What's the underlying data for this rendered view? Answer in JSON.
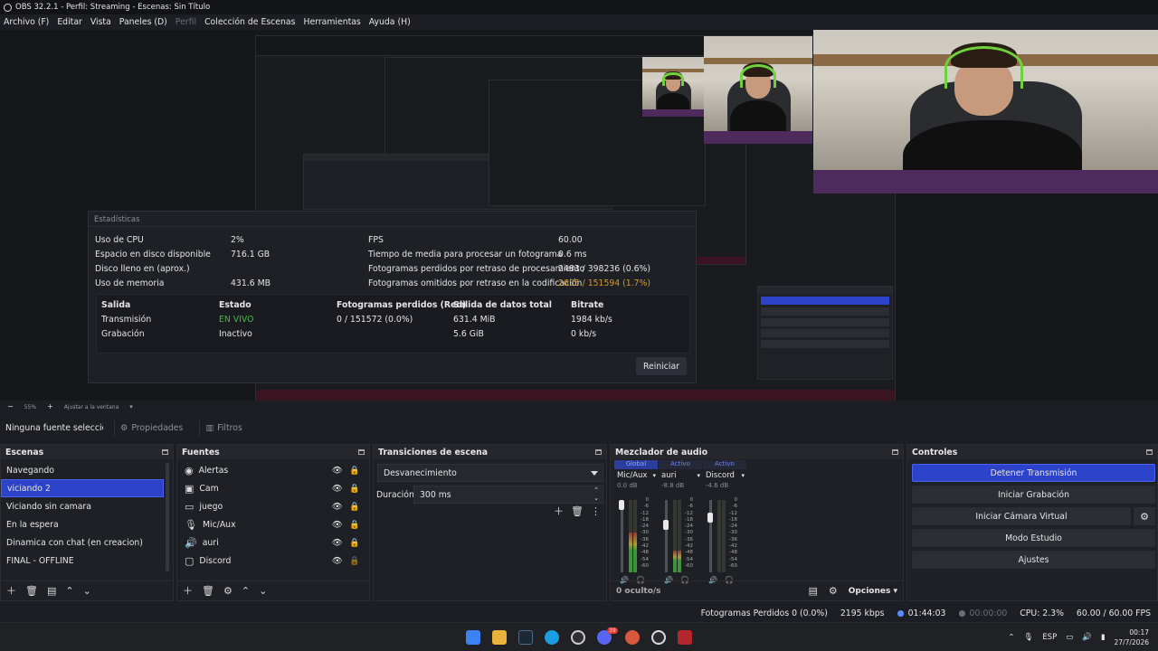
{
  "window": {
    "title": "OBS 32.2.1 - Perfil: Streaming - Escenas: Sin Título"
  },
  "menu": [
    {
      "label": "Archivo (F)",
      "dim": false
    },
    {
      "label": "Editar",
      "dim": false
    },
    {
      "label": "Vista",
      "dim": false
    },
    {
      "label": "Paneles (D)",
      "dim": false
    },
    {
      "label": "Perfil",
      "dim": true
    },
    {
      "label": "Colección de Escenas",
      "dim": false
    },
    {
      "label": "Herramientas",
      "dim": false
    },
    {
      "label": "Ayuda (H)",
      "dim": false
    }
  ],
  "stats": {
    "title": "Estadísticas",
    "left": [
      {
        "label": "Uso de CPU",
        "value": "2%"
      },
      {
        "label": "Espacio en disco disponible",
        "value": "716.1 GB"
      },
      {
        "label": "Disco lleno en (aprox.)",
        "value": ""
      },
      {
        "label": "Uso de memoria",
        "value": "431.6 MB"
      }
    ],
    "right": [
      {
        "label": "FPS",
        "value": "60.00"
      },
      {
        "label": "Tiempo de media para procesar un fotograma",
        "value": "0.6 ms"
      },
      {
        "label": "Fotogramas perdidos por retraso de procesamiento",
        "value": "2483 / 398236 (0.6%)"
      },
      {
        "label": "Fotogramas omitidos por retraso en la codificación",
        "value": "2635 / 151594 (1.7%)"
      }
    ],
    "table": {
      "headers": [
        "Salida",
        "Estado",
        "Fotogramas perdidos (Red)",
        "Salida de datos total",
        "Bitrate"
      ],
      "rows": [
        [
          "Transmisión",
          "EN VIVO",
          "0 / 151572 (0.0%)",
          "631.4 MiB",
          "1984 kb/s"
        ],
        [
          "Grabación",
          "Inactivo",
          "",
          "5.6 GiB",
          "0 kb/s"
        ]
      ]
    },
    "reset_label": "Reiniciar"
  },
  "zoom": {
    "value": "55%",
    "fit": "Ajustar a la ventana"
  },
  "sourcebar": {
    "no_source": "Ninguna fuente seleccionac",
    "properties": "Propiedades",
    "filters": "Filtros"
  },
  "scenes": {
    "title": "Escenas",
    "items": [
      "Navegando",
      "viciando 2",
      "Viciando sin camara",
      "En la espera",
      "Dinamica con chat (en creacion)",
      "FINAL - OFFLINE"
    ],
    "selected_index": 1
  },
  "sources": {
    "title": "Fuentes",
    "items": [
      {
        "label": "Alertas",
        "icon": "browser-icon"
      },
      {
        "label": "Cam",
        "icon": "camera-icon"
      },
      {
        "label": "juego",
        "icon": "monitor-icon"
      },
      {
        "label": "Mic/Aux",
        "icon": "microphone-icon"
      },
      {
        "label": "auri",
        "icon": "speaker-icon"
      },
      {
        "label": "Discord",
        "icon": "window-icon"
      }
    ]
  },
  "transitions": {
    "title": "Transiciones de escena",
    "selected": "Desvanecimiento",
    "duration_label": "Duración",
    "duration_value": "300 ms"
  },
  "mixer": {
    "title": "Mezclador de audio",
    "channels": [
      {
        "tab": "Global",
        "name": "Mic/Aux",
        "db": "0.0 dB",
        "level": 0.55,
        "fader": 1.0
      },
      {
        "tab": "Activo",
        "name": "auri",
        "db": "-8.8 dB",
        "level": 0.3,
        "fader": 0.72
      },
      {
        "tab": "Activo",
        "name": "Discord",
        "db": "-4.6 dB",
        "level": 0.0,
        "fader": 0.82
      }
    ],
    "scale": [
      "0",
      "-6",
      "-12",
      "-18",
      "-24",
      "-30",
      "-36",
      "-42",
      "-48",
      "-54",
      "-60"
    ],
    "hidden": "0 oculto/s",
    "options": "Opciones"
  },
  "controls": {
    "title": "Controles",
    "buttons": [
      "Detener Transmisión",
      "Iniciar Grabación",
      "Iniciar Cámara Virtual",
      "Modo Estudio",
      "Ajustes"
    ]
  },
  "status": {
    "dropped": "Fotogramas Perdidos 0 (0.0%)",
    "kbps": "2195 kbps",
    "stream_time": "01:44:03",
    "rec_time": "00:00:00",
    "cpu": "CPU: 2.3%",
    "fps": "60.00 / 60.00 FPS"
  },
  "taskbar": {
    "lang": "ESP",
    "time": "00:17",
    "date": "27/7/2026",
    "discord_badge": "39"
  },
  "colors": {
    "accent": "#2c43c9",
    "live": "#3fbf3f",
    "warning": "#d49a2b"
  }
}
